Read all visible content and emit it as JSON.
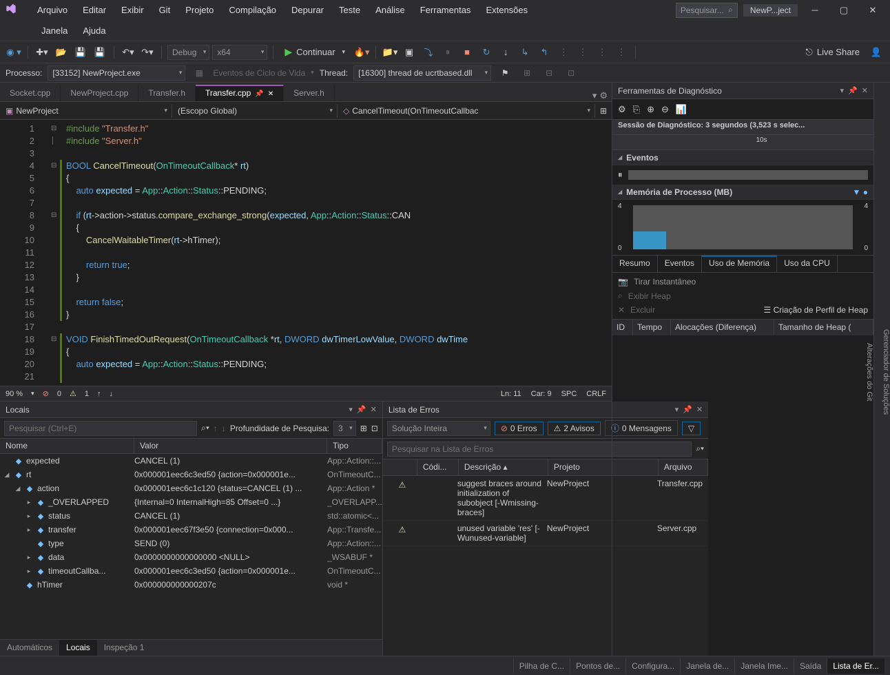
{
  "menu": [
    "Arquivo",
    "Editar",
    "Exibir",
    "Git",
    "Projeto",
    "Compilação",
    "Depurar",
    "Teste",
    "Análise",
    "Ferramentas",
    "Extensões"
  ],
  "menu2": [
    "Janela",
    "Ajuda"
  ],
  "search_placeholder": "Pesquisar...",
  "solution_name": "NewP...ject",
  "toolbar": {
    "config": "Debug",
    "platform": "x64",
    "continue": "Continuar",
    "live_share": "Live Share"
  },
  "debugbar": {
    "process_label": "Processo:",
    "process_value": "[33152] NewProject.exe",
    "lifecycle": "Eventos de Ciclo de Vida",
    "thread_label": "Thread:",
    "thread_value": "[16300] thread de ucrtbased.dll"
  },
  "tabs": [
    {
      "name": "Socket.cpp",
      "active": false
    },
    {
      "name": "NewProject.cpp",
      "active": false
    },
    {
      "name": "Transfer.h",
      "active": false
    },
    {
      "name": "Transfer.cpp",
      "active": true
    },
    {
      "name": "Server.h",
      "active": false
    }
  ],
  "nav": {
    "project": "NewProject",
    "scope": "(Escopo Global)",
    "func": "CancelTimeout(OnTimeoutCallbac"
  },
  "code_lines": [
    {
      "n": 1,
      "fold": "⊟",
      "html": "<span class='kw-comment'>#include </span><span class='kw-str'>\"Transfer.h\"</span>"
    },
    {
      "n": 2,
      "fold": "│",
      "html": "<span class='kw-comment'>#include </span><span class='kw-str'>\"Server.h\"</span>"
    },
    {
      "n": 3,
      "html": ""
    },
    {
      "n": 4,
      "fold": "⊟",
      "green": true,
      "html": "<span class='kw-blue'>BOOL</span> <span class='kw-yellow'>CancelTimeout</span>(<span class='kw-type'>OnTimeoutCallback</span>* <span class='kw-param'>rt</span>)"
    },
    {
      "n": 5,
      "green": true,
      "html": "{"
    },
    {
      "n": 6,
      "green": true,
      "html": "    <span class='kw-blue'>auto</span> <span class='kw-param'>expected</span> = <span class='kw-type'>App</span>::<span class='kw-type'>Action</span>::<span class='kw-type'>Status</span>::PENDING;"
    },
    {
      "n": 7,
      "green": true,
      "html": ""
    },
    {
      "n": 8,
      "fold": "⊟",
      "green": true,
      "html": "    <span class='kw-blue'>if</span> (<span class='kw-param'>rt</span>-&gt;action-&gt;status.<span class='kw-yellow'>compare_exchange_strong</span>(<span class='kw-param'>expected</span>, <span class='kw-type'>App</span>::<span class='kw-type'>Action</span>::<span class='kw-type'>Status</span>::CAN"
    },
    {
      "n": 9,
      "green": true,
      "html": "    {"
    },
    {
      "n": 10,
      "green": true,
      "html": "        <span class='kw-yellow'>CancelWaitableTimer</span>(<span class='kw-param'>rt</span>-&gt;hTimer);"
    },
    {
      "n": 11,
      "green": true,
      "html": "        "
    },
    {
      "n": 12,
      "green": true,
      "html": "        <span class='kw-blue'>return</span> <span class='kw-blue'>true</span>;"
    },
    {
      "n": 13,
      "green": true,
      "html": "    }"
    },
    {
      "n": 14,
      "green": true,
      "html": ""
    },
    {
      "n": 15,
      "green": true,
      "bp": true,
      "html": "    <span class='kw-blue'>return</span> <span class='kw-blue'>false</span>;"
    },
    {
      "n": 16,
      "green": true,
      "html": "}"
    },
    {
      "n": 17,
      "html": ""
    },
    {
      "n": 18,
      "fold": "⊟",
      "green": true,
      "html": "<span class='kw-blue'>VOID</span> <span class='kw-yellow'>FinishTimedOutRequest</span>(<span class='kw-type'>OnTimeoutCallback</span> *<span class='kw-param'>rt</span>, <span class='kw-blue'>DWORD</span> <span class='kw-param'>dwTimerLowValue</span>, <span class='kw-blue'>DWORD</span> <span class='kw-param'>dwTime</span>"
    },
    {
      "n": 19,
      "green": true,
      "html": "{"
    },
    {
      "n": 20,
      "green": true,
      "html": "    <span class='kw-blue'>auto</span> <span class='kw-param'>expected</span> = <span class='kw-type'>App</span>::<span class='kw-type'>Action</span>::<span class='kw-type'>Status</span>::PENDING;"
    },
    {
      "n": 21,
      "green": true,
      "html": ""
    }
  ],
  "editor_status": {
    "zoom": "90 %",
    "errors": "0",
    "warnings": "1",
    "ln": "Ln: 11",
    "col": "Car: 9",
    "spc": "SPC",
    "crlf": "CRLF"
  },
  "locals": {
    "title": "Locais",
    "search_placeholder": "Pesquisar (Ctrl+E)",
    "depth_label": "Profundidade de Pesquisa:",
    "depth_value": "3",
    "cols": [
      "Nome",
      "Valor",
      "Tipo"
    ],
    "rows": [
      {
        "indent": 0,
        "arrow": "",
        "name": "expected",
        "val": "CANCEL (1)",
        "type": "App::Action::..."
      },
      {
        "indent": 0,
        "arrow": "◢",
        "name": "rt",
        "val": "0x000001eec6c3ed50 {action=0x000001e...",
        "type": "OnTimeoutC..."
      },
      {
        "indent": 1,
        "arrow": "◢",
        "name": "action",
        "val": "0x000001eec6c1c120 {status=CANCEL (1) ...",
        "type": "App::Action *"
      },
      {
        "indent": 2,
        "arrow": "▸",
        "name": "_OVERLAPPED",
        "val": "{Internal=0 InternalHigh=85 Offset=0 ...}",
        "type": "_OVERLAPP..."
      },
      {
        "indent": 2,
        "arrow": "▸",
        "name": "status",
        "val": "CANCEL (1)",
        "type": "std::atomic<..."
      },
      {
        "indent": 2,
        "arrow": "▸",
        "name": "transfer",
        "val": "0x000001eec67f3e50 {connection=0x000...",
        "type": "App::Transfe..."
      },
      {
        "indent": 2,
        "arrow": "",
        "name": "type",
        "val": "SEND (0)",
        "type": "App::Action::..."
      },
      {
        "indent": 2,
        "arrow": "▸",
        "name": "data",
        "val": "0x0000000000000000 <NULL>",
        "type": "_WSABUF *"
      },
      {
        "indent": 2,
        "arrow": "▸",
        "name": "timeoutCallba...",
        "val": "0x000001eec6c3ed50 {action=0x000001e...",
        "type": "OnTimeoutC..."
      },
      {
        "indent": 1,
        "arrow": "",
        "name": "hTimer",
        "val": "0x000000000000207c",
        "type": "void *"
      }
    ],
    "bottom_tabs": [
      "Automáticos",
      "Locais",
      "Inspeção 1"
    ],
    "active_bottom_tab": 1
  },
  "errlist": {
    "title": "Lista de Erros",
    "scope": "Solução Inteira",
    "err_count": "0 Erros",
    "warn_count": "2 Avisos",
    "msg_count": "0 Mensagens",
    "search_placeholder": "Pesquisar na Lista de Erros",
    "cols": [
      "",
      "Códi...",
      "Descrição",
      "Projeto",
      "Arquivo"
    ],
    "rows": [
      {
        "desc": "suggest braces around initialization of subobject [-Wmissing-braces]",
        "proj": "NewProject",
        "file": "Transfer.cpp"
      },
      {
        "desc": "unused variable 'res' [-Wunused-variable]",
        "proj": "NewProject",
        "file": "Server.cpp"
      }
    ]
  },
  "diag": {
    "title": "Ferramentas de Diagnóstico",
    "session": "Sessão de Diagnóstico: 3 segundos (3,523 s selec...",
    "time_mark": "10s",
    "events_label": "Eventos",
    "mem_label": "Memória de Processo (MB)",
    "mem_max": "4",
    "mem_min": "0",
    "tabs": [
      "Resumo",
      "Eventos",
      "Uso de Memória",
      "Uso da CPU"
    ],
    "active_tab": 2,
    "actions": [
      "Tirar Instantâneo",
      "Exibir Heap",
      "Excluir"
    ],
    "heap_profile": "Criação de Perfil de Heap",
    "table_cols": [
      "ID",
      "Tempo",
      "Alocações (Diferença)",
      "Tamanho de Heap ("
    ]
  },
  "statusbar_tabs": [
    "Pilha de C...",
    "Pontos de...",
    "Configura...",
    "Janela de...",
    "Janela Ime...",
    "Saída",
    "Lista de Er..."
  ],
  "statusbar_active": 6,
  "vtabs": [
    "Gerenciador de Soluções",
    "Alterações do Git"
  ]
}
